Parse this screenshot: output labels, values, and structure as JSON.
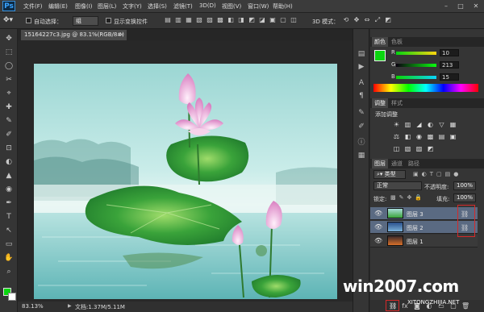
{
  "app": {
    "logo_text": "Ps"
  },
  "menu": [
    "文件(F)",
    "编辑(E)",
    "图像(I)",
    "图层(L)",
    "文字(Y)",
    "选择(S)",
    "滤镜(T)",
    "3D(D)",
    "视图(V)",
    "窗口(W)",
    "帮助(H)"
  ],
  "window_controls": {
    "minimize": "–",
    "maximize": "□",
    "close": "✕"
  },
  "options": {
    "auto_select_label": "自动选择：",
    "auto_select_value": "组",
    "show_transform_label": "显示变换控件",
    "mode_3d_label": "3D 模式："
  },
  "document": {
    "tab_title": "15164227c3.jpg @ 83.1%(RGB/8#)",
    "tab_close": "×",
    "zoom": "83.13%",
    "doc_size": "文档:1.37M/5.11M",
    "canvas_scene": {
      "sky_top": "#a9ddd9",
      "water": "#7fc8c8",
      "leaf_green": "#2f9a3a",
      "lotus_pink": "#e7a9d4"
    }
  },
  "panels": {
    "color": {
      "tabs": [
        "颜色",
        "色板"
      ],
      "labels": {
        "r": "R",
        "g": "G",
        "b": "B"
      },
      "r": "10",
      "g": "213",
      "b": "15",
      "foreground": "#0ad50f"
    },
    "adjustments": {
      "tabs": [
        "调整",
        "样式"
      ],
      "add_label": "添加调整",
      "icons": [
        "brightness-icon",
        "levels-icon",
        "curves-icon",
        "exposure-icon",
        "vibrance-icon",
        "hue-icon",
        "color-balance-icon",
        "bw-icon",
        "photo-filter-icon",
        "channel-mixer-icon",
        "color-lookup-icon",
        "invert-icon",
        "posterize-icon",
        "threshold-icon",
        "gradient-map-icon",
        "selective-color-icon"
      ],
      "glyphs": [
        "☀",
        "▥",
        "◢",
        "◐",
        "▽",
        "▦",
        "⚖",
        "◧",
        "◉",
        "▩",
        "▤",
        "▣",
        "◫",
        "▧",
        "▨",
        "◩"
      ]
    },
    "layers": {
      "tabs": [
        "图层",
        "通道",
        "路径"
      ],
      "filter_label": "类型",
      "blend_mode": "正常",
      "opacity_label": "不透明度:",
      "opacity_value": "100%",
      "lock_label": "锁定:",
      "fill_label": "填充:",
      "fill_value": "100%",
      "items": [
        {
          "name": "图层 3",
          "selected": true,
          "linked": true
        },
        {
          "name": "图层 2",
          "selected": true,
          "linked": true
        },
        {
          "name": "图层 1",
          "selected": false,
          "linked": false
        }
      ]
    }
  },
  "watermark": {
    "main": "win2007.com",
    "sub": "XITONGZHIJIA.NET"
  }
}
